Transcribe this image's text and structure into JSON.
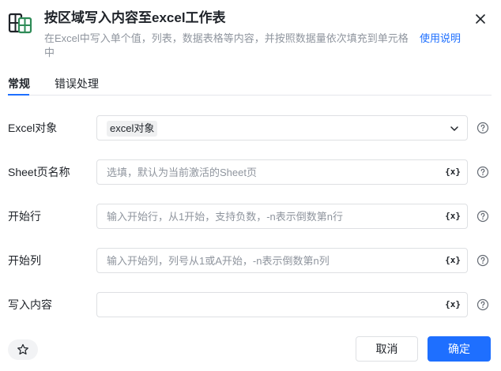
{
  "dialog": {
    "title": "按区域写入内容至excel工作表",
    "description": "在Excel中写入单个值，列表，数据表格等内容，并按照数据量依次填充到单元格中",
    "help_link": "使用说明",
    "icon": "excel-grid-icon",
    "close_icon": "close-icon"
  },
  "tabs": [
    {
      "label": "常规",
      "active": true
    },
    {
      "label": "错误处理",
      "active": false
    }
  ],
  "fields": [
    {
      "label": "Excel对象",
      "value": "excel对象",
      "placeholder": "",
      "type": "select"
    },
    {
      "label": "Sheet页名称",
      "value": "",
      "placeholder": "选填，默认为当前激活的Sheet页",
      "type": "text"
    },
    {
      "label": "开始行",
      "value": "",
      "placeholder": "输入开始行，从1开始，支持负数，-n表示倒数第n行",
      "type": "text"
    },
    {
      "label": "开始列",
      "value": "",
      "placeholder": "输入开始列，列号从1或A开始，-n表示倒数第n列",
      "type": "text"
    },
    {
      "label": "写入内容",
      "value": "",
      "placeholder": "",
      "type": "text"
    }
  ],
  "variable_button": "{x}",
  "footer": {
    "favorite_icon": "star-icon",
    "cancel_label": "取消",
    "confirm_label": "确定"
  },
  "colors": {
    "accent": "#1e6fff",
    "icon_green": "#2e8b57"
  }
}
